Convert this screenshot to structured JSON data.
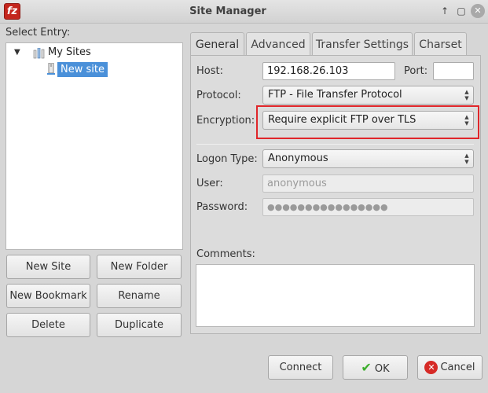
{
  "window": {
    "title": "Site Manager",
    "app_icon_text": "fz"
  },
  "left": {
    "select_entry_label": "Select Entry:",
    "tree": {
      "root": "My Sites",
      "selected_site": "New site"
    },
    "buttons": {
      "new_site": "New Site",
      "new_folder": "New Folder",
      "new_bookmark": "New Bookmark",
      "rename": "Rename",
      "delete": "Delete",
      "duplicate": "Duplicate"
    }
  },
  "tabs": [
    {
      "label": "General",
      "active": true
    },
    {
      "label": "Advanced",
      "active": false
    },
    {
      "label": "Transfer Settings",
      "active": false
    },
    {
      "label": "Charset",
      "active": false
    }
  ],
  "general": {
    "host_label": "Host:",
    "host_value": "192.168.26.103",
    "port_label": "Port:",
    "port_value": "",
    "protocol_label": "Protocol:",
    "protocol_value": "FTP - File Transfer Protocol",
    "encryption_label": "Encryption:",
    "encryption_value": "Require explicit FTP over TLS",
    "logon_type_label": "Logon Type:",
    "logon_type_value": "Anonymous",
    "user_label": "User:",
    "user_value": "anonymous",
    "password_label": "Password:",
    "password_value": "●●●●●●●●●●●●●●●●",
    "comments_label": "Comments:",
    "comments_value": ""
  },
  "footer": {
    "connect": "Connect",
    "ok": "OK",
    "cancel": "Cancel"
  },
  "colors": {
    "highlight_border": "#e0262a",
    "selection": "#4a90d9"
  }
}
